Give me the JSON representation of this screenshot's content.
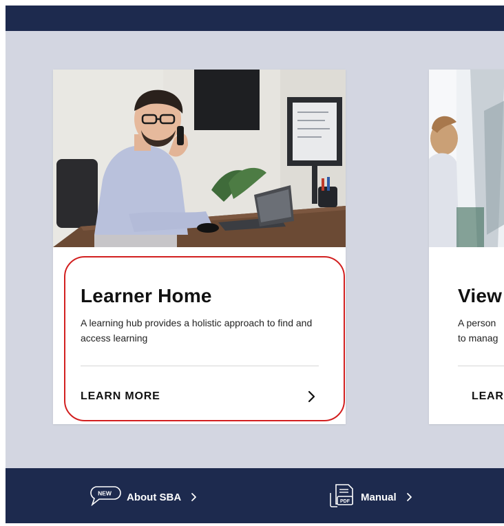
{
  "cards": [
    {
      "title": "Learner Home",
      "description": "A learning hub provides a holistic approach to find and access learning",
      "cta_label": "LEARN MORE"
    },
    {
      "title": "View",
      "description": "A person\nto manag",
      "cta_label": "LEAR"
    }
  ],
  "footer": {
    "about_label": "About SBA",
    "about_badge": "NEW",
    "manual_label": "Manual",
    "manual_badge": "PDF"
  },
  "colors": {
    "page_bg": "#d3d6e1",
    "header_footer_navy": "#1d2a4e",
    "highlight_red": "#d21f1f"
  },
  "icons": [
    "new-badge-speech-icon",
    "pdf-document-icon",
    "chevron-right-icon"
  ]
}
